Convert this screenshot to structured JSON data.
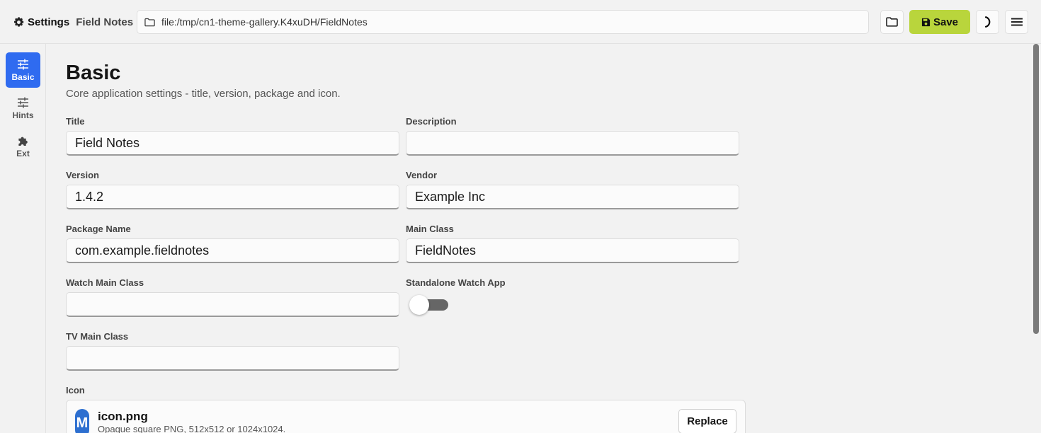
{
  "topbar": {
    "settings_label": "Settings",
    "project_name": "Field Notes",
    "path": "file:/tmp/cn1-theme-gallery.K4xuDH/FieldNotes",
    "save_label": "Save",
    "icons": [
      "gear-icon",
      "folder-icon",
      "open-folder-icon",
      "save-icon",
      "theme-toggle-icon",
      "menu-icon"
    ]
  },
  "sidebar": {
    "items": [
      {
        "label": "Basic",
        "icon": "sliders-icon",
        "active": true
      },
      {
        "label": "Hints",
        "icon": "sliders-icon",
        "active": false
      },
      {
        "label": "Ext",
        "icon": "puzzle-icon",
        "active": false
      }
    ]
  },
  "main": {
    "title": "Basic",
    "subtitle": "Core application settings - title, version, package and icon.",
    "fields": {
      "title": {
        "label": "Title",
        "value": "Field Notes"
      },
      "description": {
        "label": "Description",
        "value": ""
      },
      "version": {
        "label": "Version",
        "value": "1.4.2"
      },
      "vendor": {
        "label": "Vendor",
        "value": "Example Inc"
      },
      "package_name": {
        "label": "Package Name",
        "value": "com.example.fieldnotes"
      },
      "main_class": {
        "label": "Main Class",
        "value": "FieldNotes"
      },
      "watch_main_class": {
        "label": "Watch Main Class",
        "value": ""
      },
      "standalone_watch_app": {
        "label": "Standalone Watch App",
        "checked": false
      },
      "tv_main_class": {
        "label": "TV Main Class",
        "value": ""
      }
    },
    "icon": {
      "label": "Icon",
      "filename": "icon.png",
      "thumb_letter": "M",
      "hint": "Opaque square PNG, 512x512 or 1024x1024.",
      "replace_label": "Replace"
    }
  },
  "colors": {
    "accent_blue": "#2f6bf0",
    "save_green": "#b9d53c",
    "background": "#f2f2f2"
  }
}
